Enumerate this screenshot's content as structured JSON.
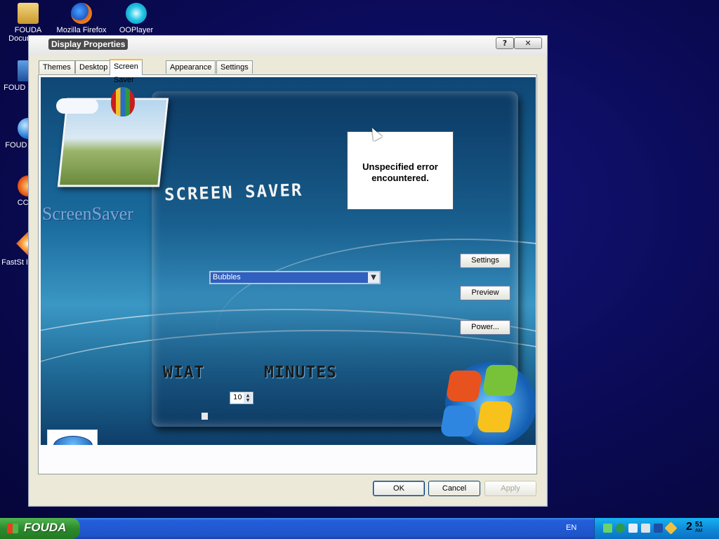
{
  "desktop": {
    "icons": [
      {
        "label": "FOUDA Documents",
        "icon": "folder-icon"
      },
      {
        "label": "Mozilla Firefox",
        "icon": "firefox-icon"
      },
      {
        "label": "OOPlayer",
        "icon": "ooplayer-icon"
      },
      {
        "label": "FOUD Compu",
        "icon": "computer-icon"
      },
      {
        "label": "FOUD Netwo",
        "icon": "network-icon"
      },
      {
        "label": "CClea",
        "icon": "ccleaner-icon"
      },
      {
        "label": "FastSt Image V",
        "icon": "faststone-icon"
      }
    ]
  },
  "window": {
    "title": "Display Properties",
    "help_label": "?",
    "close_label": "✕",
    "tabs": [
      {
        "label": "Themes",
        "active": false
      },
      {
        "label": "Desktop",
        "active": false
      },
      {
        "label": "Screen Saver",
        "active": true
      },
      {
        "label": "Appearance",
        "active": false
      },
      {
        "label": "Settings",
        "active": false
      }
    ],
    "panel": {
      "brand_text": "ScreenSaver",
      "heading": "SCREEN SAVER",
      "error_message": "Unspecified error encountered.",
      "screensaver_select": {
        "value": "Bubbles"
      },
      "settings_label": "Settings",
      "preview_label": "Preview",
      "power_label": "Power...",
      "wait_label": "WIAT",
      "minutes_label": "MINUTES",
      "wait_value": "10"
    },
    "ok_label": "OK",
    "cancel_label": "Cancel",
    "apply_label": "Apply"
  },
  "taskbar": {
    "start_label": "FOUDA",
    "language": "EN",
    "clock": {
      "hour": "2",
      "minute": "51",
      "ampm": "AM"
    }
  },
  "colors": {
    "accent": "#fbba3c",
    "taskbar": "#245edb",
    "start": "#2d8a2d"
  }
}
